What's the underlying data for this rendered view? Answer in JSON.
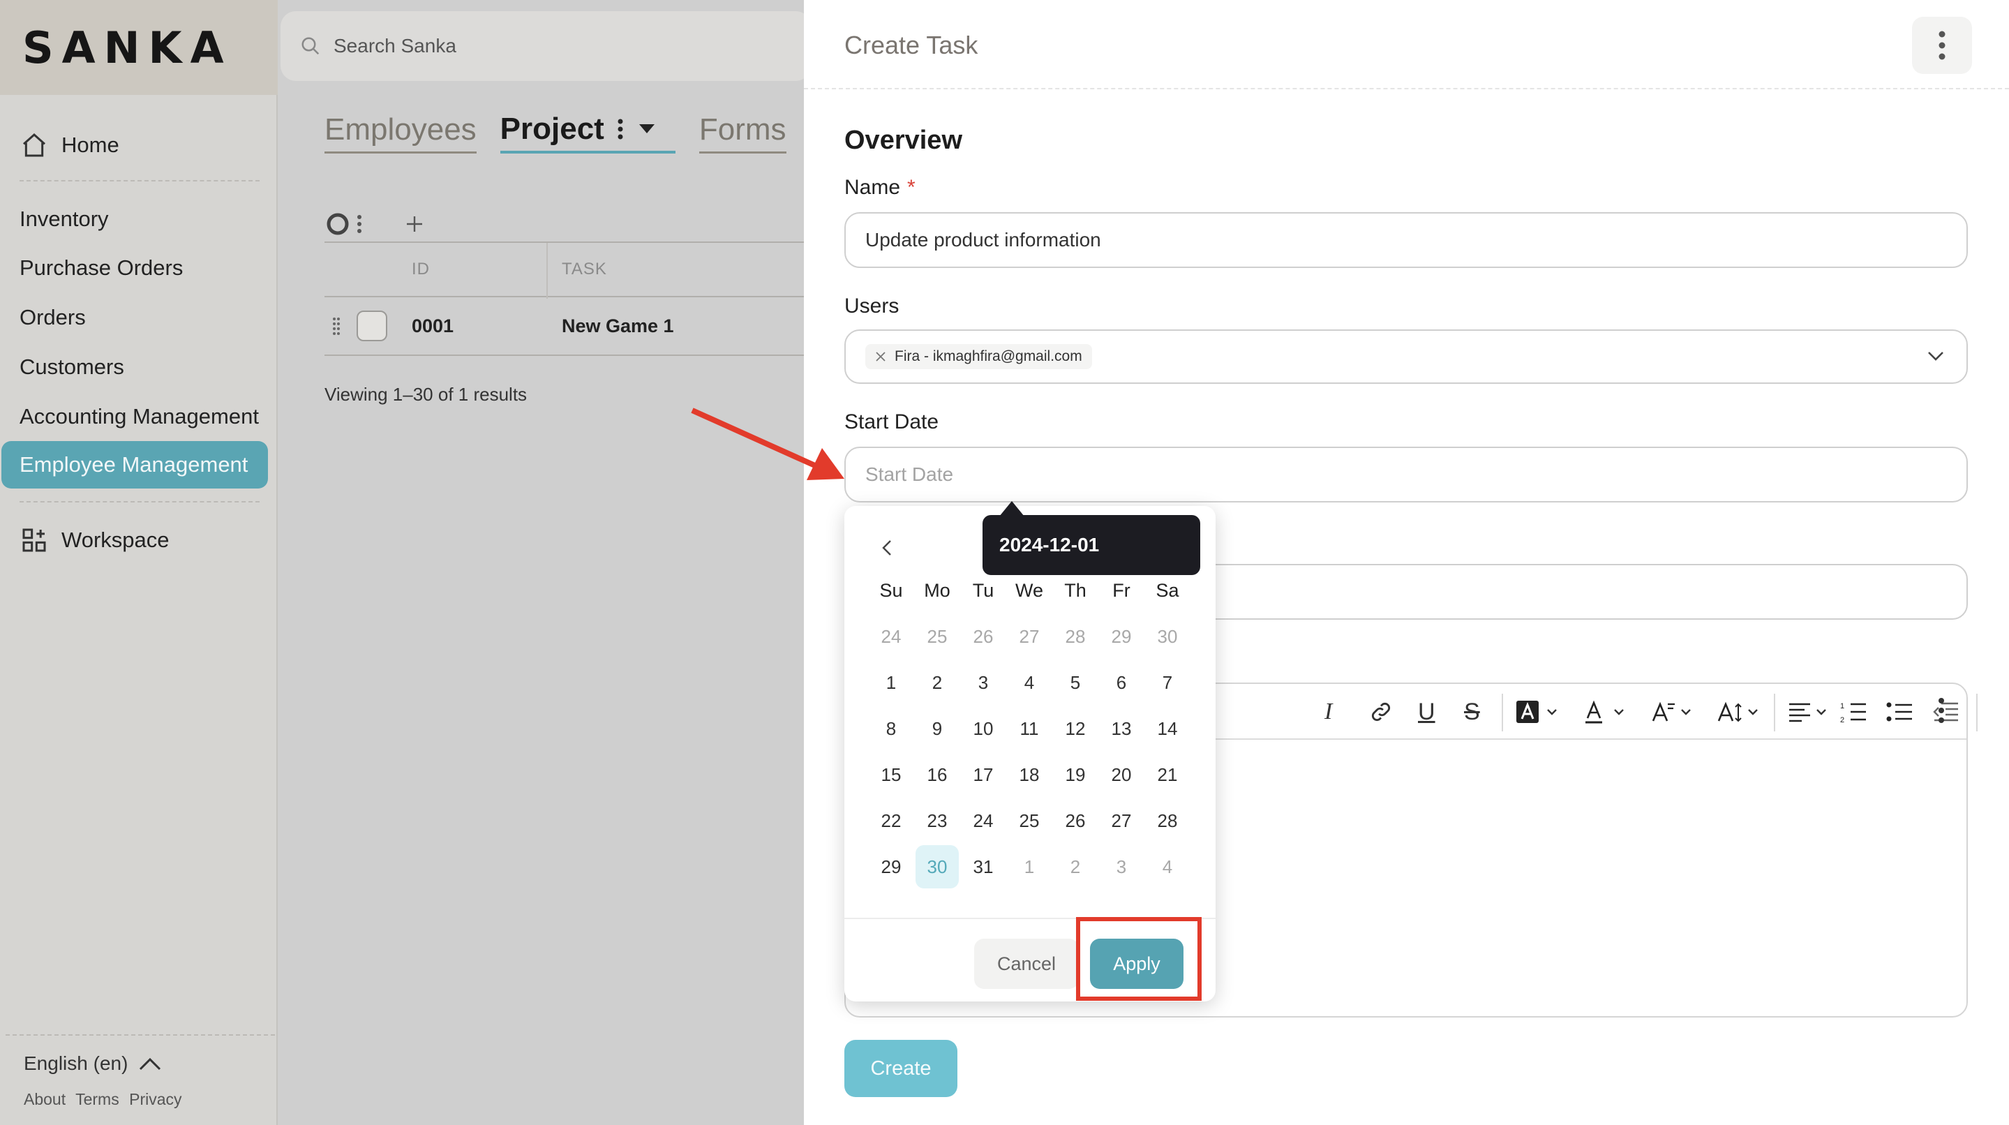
{
  "brand": {
    "name": "SANKA"
  },
  "search": {
    "placeholder": "Search Sanka"
  },
  "sidebar": {
    "home": "Home",
    "items": [
      "Inventory",
      "Purchase Orders",
      "Orders",
      "Customers",
      "Accounting Management",
      "Employee Management"
    ],
    "active": "Employee Management",
    "workspace": "Workspace",
    "language": "English (en)",
    "footer_links": [
      "About",
      "Terms",
      "Privacy"
    ]
  },
  "tabs": [
    "Employees",
    "Project",
    "Forms"
  ],
  "active_tab": "Project",
  "table": {
    "columns": [
      "ID",
      "TASK"
    ],
    "rows": [
      {
        "id": "0001",
        "task": "New Game 1"
      }
    ],
    "viewing": "Viewing 1–30 of 1 results"
  },
  "panel": {
    "title": "Create Task",
    "section": "Overview",
    "name_label": "Name",
    "required_mark": "*",
    "name_value": "Update product information",
    "users_label": "Users",
    "user_chip": "Fira - ikmaghfira@gmail.com",
    "start_date_label": "Start Date",
    "start_date_placeholder": "Start Date",
    "create_label": "Create"
  },
  "datepicker": {
    "tooltip": "2024-12-01",
    "weekdays": [
      "Su",
      "Mo",
      "Tu",
      "We",
      "Th",
      "Fr",
      "Sa"
    ],
    "weeks": [
      [
        "24",
        "25",
        "26",
        "27",
        "28",
        "29",
        "30"
      ],
      [
        "1",
        "2",
        "3",
        "4",
        "5",
        "6",
        "7"
      ],
      [
        "8",
        "9",
        "10",
        "11",
        "12",
        "13",
        "14"
      ],
      [
        "15",
        "16",
        "17",
        "18",
        "19",
        "20",
        "21"
      ],
      [
        "22",
        "23",
        "24",
        "25",
        "26",
        "27",
        "28"
      ],
      [
        "29",
        "30",
        "31",
        "1",
        "2",
        "3",
        "4"
      ]
    ],
    "selected_day": "30",
    "cancel_label": "Cancel",
    "apply_label": "Apply"
  },
  "colors": {
    "accent": "#56a3b2",
    "create_button": "#6fc2d2",
    "annotation": "#e23b2b"
  }
}
